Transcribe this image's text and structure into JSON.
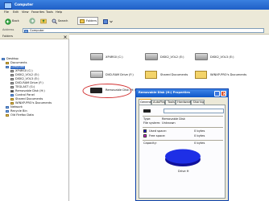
{
  "window": {
    "title": "Computer"
  },
  "menu": [
    "File",
    "Edit",
    "View",
    "Favorites",
    "Tools",
    "Help"
  ],
  "toolbar": {
    "back_label": "Back",
    "search_label": "Search",
    "folders_label": "Folders"
  },
  "address": {
    "label": "Address",
    "value": "Computer"
  },
  "sidebar": {
    "header": "Folders",
    "items": [
      {
        "label": "Desktop",
        "level": 0,
        "icon": "desktop-icon"
      },
      {
        "label": "Documents",
        "level": 1,
        "icon": "folder-icon"
      },
      {
        "label": "Computer",
        "level": 1,
        "icon": "computer-icon"
      },
      {
        "label": "XP4RS0 (C:)",
        "level": 2,
        "icon": "drive-icon"
      },
      {
        "label": "DISK2_VOL2 (E:)",
        "level": 2,
        "icon": "drive-icon"
      },
      {
        "label": "DISK2_VOL3 (E:)",
        "level": 2,
        "icon": "drive-icon"
      },
      {
        "label": "DVD-RAM Drive (F:)",
        "level": 2,
        "icon": "dvd-drive-icon"
      },
      {
        "label": "TEGLAST (G:)",
        "level": 2,
        "icon": "drive-icon"
      },
      {
        "label": "Removable Disk (H:)",
        "level": 2,
        "icon": "removable-disk-icon"
      },
      {
        "label": "Control Panel",
        "level": 2,
        "icon": "control-panel-icon"
      },
      {
        "label": "Shared Documents",
        "level": 2,
        "icon": "folder-icon"
      },
      {
        "label": "WINXP-PRO's Documents",
        "level": 2,
        "icon": "folder-icon"
      },
      {
        "label": "Network",
        "level": 1,
        "icon": "network-icon"
      },
      {
        "label": "Recycle Bin",
        "level": 1,
        "icon": "recycle-bin-icon"
      },
      {
        "label": "Old Firefox Data",
        "level": 1,
        "icon": "folder-icon"
      }
    ]
  },
  "content_items": [
    {
      "label": "XP4RS0 (C:)",
      "icon": "hard-drive-icon"
    },
    {
      "label": "DISK2_VOL2 (E:)",
      "icon": "hard-drive-icon"
    },
    {
      "label": "DISK2_VOL3 (E:)",
      "icon": "hard-drive-icon"
    },
    {
      "label": "DVD-RAM Drive (F:)",
      "icon": "dvd-drive-icon"
    },
    {
      "label": "Shared Documents",
      "icon": "folder-icon"
    },
    {
      "label": "WINXP-PRO's Documents",
      "icon": "folder-icon"
    },
    {
      "label": "Removable Disk (H:)",
      "icon": "removable-disk-icon"
    }
  ],
  "dialog": {
    "title": "Removable Disk (H:) Properties",
    "tabs": [
      "General",
      "AutoPlay",
      "Tools",
      "Hardware",
      "Sharing"
    ],
    "active_tab": "General",
    "type_label": "Type:",
    "type_value": "Removable Disk",
    "fs_label": "File system:",
    "fs_value": "Unknown",
    "used_label": "Used space:",
    "used_value": "0 bytes",
    "used_color": "#1c1cd8",
    "free_label": "Free space:",
    "free_value": "0 bytes",
    "free_color": "#d81cd8",
    "capacity_label": "Capacity:",
    "capacity_value": "0 bytes",
    "drive_label": "Drive H",
    "used_fraction": 0
  }
}
